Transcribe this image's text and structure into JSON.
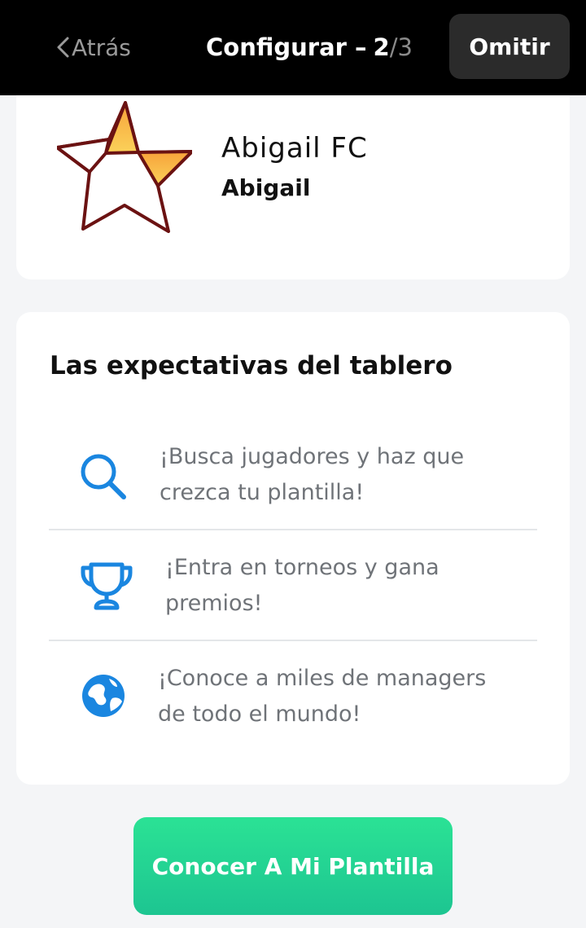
{
  "header": {
    "back_label": "Atrás",
    "title": "Configurar –",
    "step_current": "2",
    "step_separator": "/",
    "step_total": "3",
    "skip_label": "Omitir"
  },
  "club": {
    "name": "Abigail FC",
    "manager": "Abigail",
    "logo_icon": "star-crest-icon"
  },
  "board": {
    "title": "Las expectativas del tablero",
    "items": [
      {
        "icon": "search-icon",
        "text": "¡Busca jugadores y haz que crezca tu plantilla!"
      },
      {
        "icon": "trophy-icon",
        "text": "¡Entra en torneos y gana premios!"
      },
      {
        "icon": "globe-icon",
        "text": "¡Conoce a miles de managers de todo el mundo!"
      }
    ]
  },
  "cta": {
    "label": "Conocer A Mi Plantilla"
  },
  "colors": {
    "accent_blue": "#1a86e0",
    "cta_green": "#22d693",
    "header_bg": "#000000",
    "skip_bg": "#2b2b2b"
  }
}
